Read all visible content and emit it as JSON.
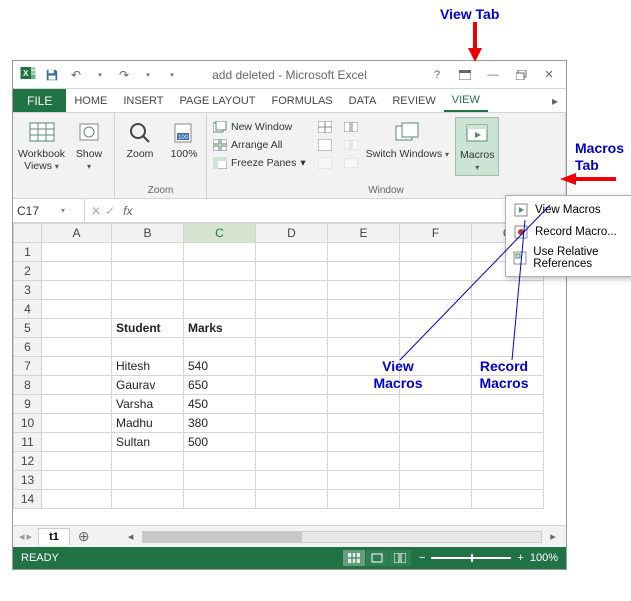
{
  "annotations": {
    "view_tab": "View Tab",
    "macros_tab": "Macros Tab",
    "view_macros": "View Macros",
    "record_macros": "Record Macros"
  },
  "titlebar": {
    "title": "add deleted - Microsoft Excel"
  },
  "tabs": {
    "file": "FILE",
    "home": "HOME",
    "insert": "INSERT",
    "page_layout": "PAGE LAYOUT",
    "formulas": "FORMULAS",
    "data": "DATA",
    "review": "REVIEW",
    "view": "VIEW"
  },
  "ribbon": {
    "workbook_views": "Workbook Views",
    "show": "Show",
    "zoom": "Zoom",
    "hundred": "100%",
    "zoom_group": "Zoom",
    "new_window": "New Window",
    "arrange_all": "Arrange All",
    "freeze_panes": "Freeze Panes",
    "switch_windows": "Switch Windows",
    "window_group": "Window",
    "macros": "Macros"
  },
  "dropdown": {
    "view_macros": "View Macros",
    "record_macro": "Record Macro...",
    "use_relative": "Use Relative References"
  },
  "namebox": {
    "ref": "C17"
  },
  "formula_bar": {
    "fx": "fx"
  },
  "columns": [
    "A",
    "B",
    "C",
    "D",
    "E",
    "F",
    "G"
  ],
  "grid": {
    "b5": "Student",
    "c5": "Marks",
    "b7": "Hitesh",
    "c7": "540",
    "b8": "Gaurav",
    "c8": "650",
    "b9": "Varsha",
    "c9": "450",
    "b10": "Madhu",
    "c10": "380",
    "b11": "Sultan",
    "c11": "500"
  },
  "sheet_tab": "t1",
  "statusbar": {
    "ready": "READY",
    "zoom": "100%"
  },
  "chart_data": {
    "type": "table",
    "columns": [
      "Student",
      "Marks"
    ],
    "rows": [
      [
        "Hitesh",
        540
      ],
      [
        "Gaurav",
        650
      ],
      [
        "Varsha",
        450
      ],
      [
        "Madhu",
        380
      ],
      [
        "Sultan",
        500
      ]
    ]
  }
}
